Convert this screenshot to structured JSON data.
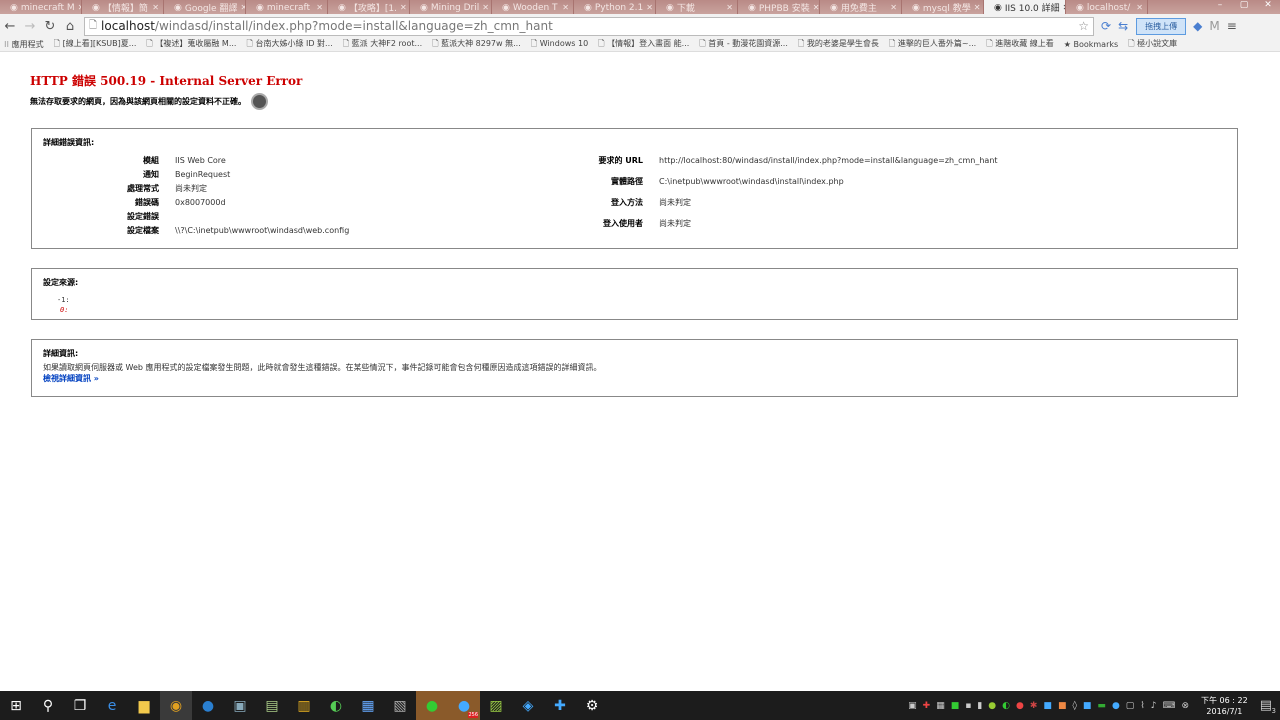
{
  "browser": {
    "tabs": [
      "minecraft M",
      "【情報】簡",
      "Google 翻譯",
      "minecraft",
      "【攻略】[1.",
      "Mining Dril",
      "Wooden T",
      "Python 2.1",
      "下載",
      "PHPBB 安裝",
      "用免費主",
      "mysql 教學",
      "IIS 10.0 詳細",
      "localhost/"
    ],
    "active_tab": 12,
    "url_host": "localhost",
    "url_path": "/windasd/install/index.php?mode=install&language=zh_cmn_hant",
    "upload_button": "拖拽上傳",
    "profile_initial": "M",
    "bookmarks": [
      "應用程式",
      "[線上看][KSUB]夏...",
      "【複述】蒐收屬融 M...",
      "台南大姊小綠 ID 對...",
      "藍派 大神F2 root...",
      "藍派大神 8297w 無...",
      "Windows 10",
      "【情報】登入畫面 能...",
      "首頁 - 動漫花園資源...",
      "我的老婆是學生會長",
      "進擊的巨人番外篇~...",
      "進階收藏 線上看",
      "Bookmarks",
      "極小說文庫"
    ]
  },
  "error": {
    "title": "HTTP 錯誤 500.19 - Internal Server Error",
    "subtitle": "無法存取要求的網頁，因為與該網頁相關的設定資料不正確。",
    "details_heading": "詳細錯誤資訊:",
    "left": [
      {
        "k": "模組",
        "v": "IIS Web Core"
      },
      {
        "k": "通知",
        "v": "BeginRequest"
      },
      {
        "k": "處理常式",
        "v": "尚未判定"
      },
      {
        "k": "錯誤碼",
        "v": "0x8007000d"
      },
      {
        "k": "設定錯誤",
        "v": ""
      },
      {
        "k": "設定檔案",
        "v": "\\\\?\\C:\\inetpub\\wwwroot\\windasd\\web.config"
      }
    ],
    "right": [
      {
        "k": "要求的 URL",
        "v": "http://localhost:80/windasd/install/index.php?mode=install&language=zh_cmn_hant"
      },
      {
        "k": "實體路徑",
        "v": "C:\\inetpub\\wwwroot\\windasd\\install\\index.php"
      },
      {
        "k": "登入方法",
        "v": "尚未判定"
      },
      {
        "k": "登入使用者",
        "v": "尚未判定"
      }
    ],
    "source_heading": "設定來源:",
    "source_line1": "-1:",
    "source_line2": "0:",
    "more_heading": "詳細資訊:",
    "more_text": "如果讀取網頁伺服器或 Web 應用程式的設定檔案發生問題，此時就會發生這種錯誤。在某些情況下，事件記錄可能會包含何種原因造成這項錯誤的詳細資訊。",
    "more_link": "檢視詳細資訊 »"
  },
  "taskbar": {
    "time": "下午 06 : 22",
    "date": "2016/7/1",
    "notifications": "3",
    "badge": "256"
  }
}
